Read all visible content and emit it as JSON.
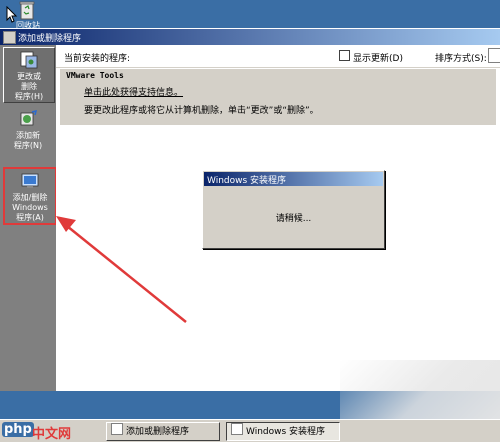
{
  "desktop": {
    "recycle_label": "回收站"
  },
  "window": {
    "title": "添加或删除程序"
  },
  "sidebar": {
    "items": [
      {
        "label": "更改或\n删除\n程序(H)"
      },
      {
        "label": "添加新\n程序(N)"
      },
      {
        "label": "添加/删除\nWindows\n程序(A)"
      }
    ]
  },
  "content": {
    "current_label": "当前安装的程序:",
    "show_updates_label": "显示更新(D)",
    "sort_label": "排序方式(S):",
    "program": {
      "name": "VMware Tools",
      "support_link": "单击此处获得支持信息。",
      "description": "要更改此程序或将它从计算机删除，单击“更改”或“删除”。"
    }
  },
  "dialog": {
    "title": "Windows 安装程序",
    "message": "请稍候..."
  },
  "taskbar": {
    "items": [
      {
        "label": "添加或删除程序"
      },
      {
        "label": "Windows 安装程序"
      }
    ]
  },
  "watermark": {
    "logo": "php",
    "text": "中文网"
  },
  "colors": {
    "highlight": "#e03a3a",
    "titlebar": "#0a246a",
    "desktop": "#3a6ea5"
  }
}
